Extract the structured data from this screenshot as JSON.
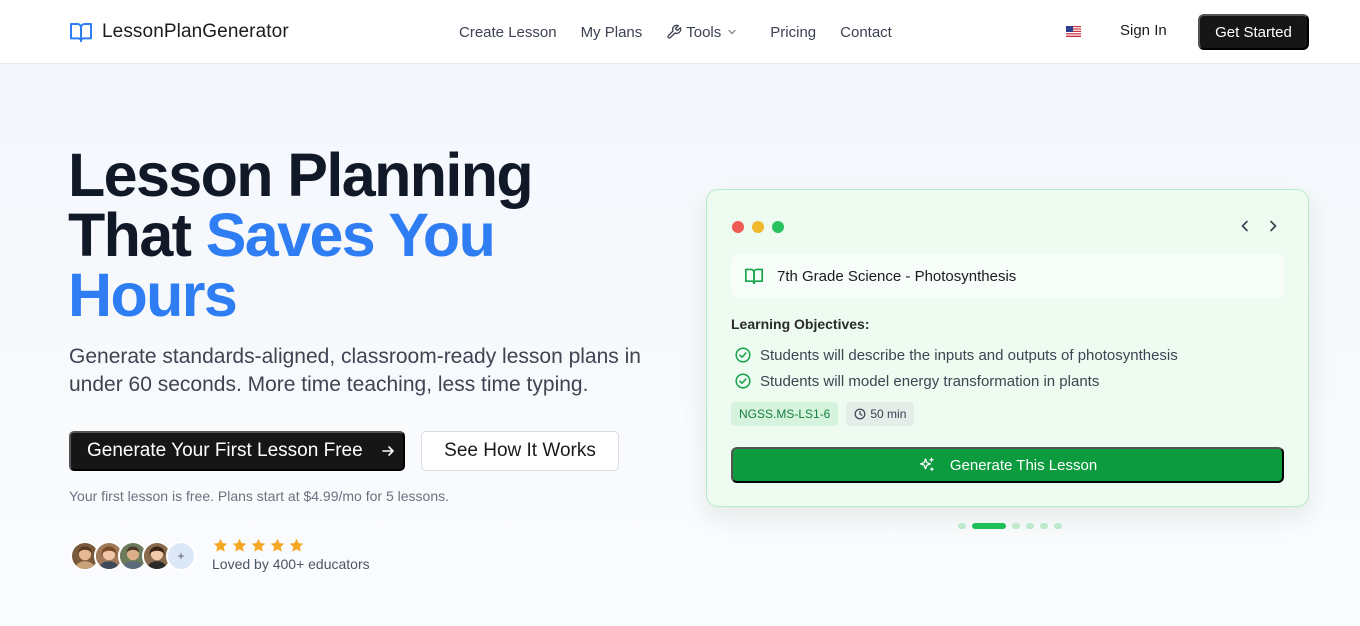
{
  "header": {
    "logo_text": "LessonPlanGenerator",
    "nav": {
      "create": "Create Lesson",
      "plans": "My Plans",
      "tools": "Tools",
      "pricing": "Pricing",
      "contact": "Contact"
    },
    "sign_in": "Sign In",
    "get_started": "Get Started"
  },
  "hero": {
    "title_line1": "Lesson Planning",
    "title_line2_a": "That ",
    "title_line2_b": "Saves You",
    "title_line3": "Hours",
    "subtitle": "Generate standards-aligned, classroom-ready lesson plans in under 60 seconds. More time teaching, less time typing.",
    "primary_cta": "Generate Your First Lesson Free",
    "secondary_cta": "See How It Works",
    "fine_print": "Your first lesson is free. Plans start at $4.99/mo for 5 lessons.",
    "avatar_more": "+",
    "rating_stars": 5,
    "loved_text": "Loved by 400+ educators"
  },
  "preview_card": {
    "lesson_title": "7th Grade Science - Photosynthesis",
    "objectives_heading": "Learning Objectives:",
    "objectives": [
      "Students will describe the inputs and outputs of photosynthesis",
      "Students will model energy transformation in plants"
    ],
    "standard_tag": "NGSS.MS-LS1-6",
    "duration_tag": "50 min",
    "generate_button": "Generate This Lesson",
    "carousel_active_index": 1,
    "carousel_count": 6
  },
  "colors": {
    "accent_blue": "#2f7df2",
    "brand_dark": "#161616",
    "card_green_bg": "#eefbf1",
    "cta_green": "#0c9b3e"
  },
  "icons": {
    "logo": "open-book-icon",
    "tools": "wrench-icon",
    "tools_dropdown": "chevron-down-icon",
    "locale": "us-flag-icon",
    "primary_cta": "arrow-right-icon",
    "rating": "star-icon",
    "lesson": "book-icon",
    "objective": "check-circle-icon",
    "duration": "clock-icon",
    "generate": "sparkle-icon",
    "card_prev": "chevron-left-icon",
    "card_next": "chevron-right-icon"
  }
}
